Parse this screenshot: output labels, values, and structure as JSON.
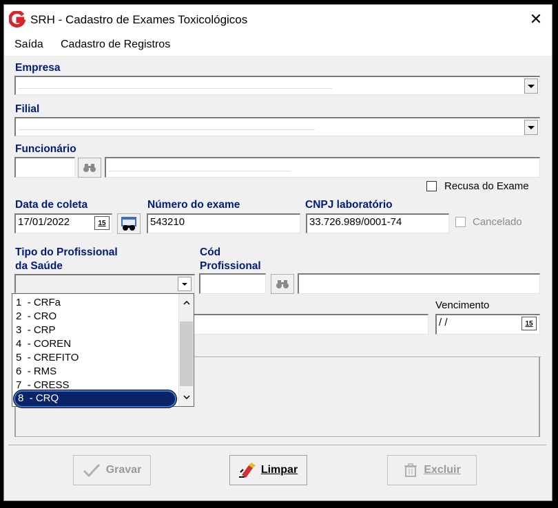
{
  "window": {
    "title": "SRH - Cadastro de Exames Toxicológicos",
    "close_glyph": "✕"
  },
  "menu": {
    "items": [
      "Saída",
      "Cadastro de Registros"
    ]
  },
  "form": {
    "empresa_label": "Empresa",
    "filial_label": "Filial",
    "funcionario_label": "Funcionário",
    "recusa_label": "Recusa do Exame",
    "data_coleta_label": "Data de coleta",
    "data_coleta_value": "17/01/2022",
    "numero_exame_label": "Número do exame",
    "numero_exame_value": "543210",
    "cnpj_label": "CNPJ laboratório",
    "cnpj_value": "33.726.989/0001-74",
    "cancelado_label": "Cancelado",
    "tipo_prof_label_1": "Tipo do Profissional",
    "tipo_prof_label_2": "da Saúde",
    "cod_prof_label_1": "Cód",
    "cod_prof_label_2": "Profissional",
    "vencimento_label": "Vencimento",
    "vencimento_value": " / /",
    "calendar_day": "15"
  },
  "dropdown_list": {
    "items": [
      {
        "num": "1",
        "text": "- CRFa"
      },
      {
        "num": "2",
        "text": "- CRO"
      },
      {
        "num": "3",
        "text": "- CRP"
      },
      {
        "num": "4",
        "text": "- COREN"
      },
      {
        "num": "5",
        "text": "- CREFITO"
      },
      {
        "num": "6",
        "text": "- RMS"
      },
      {
        "num": "7",
        "text": "- CRESS"
      },
      {
        "num": "8",
        "text": "- CRQ"
      }
    ],
    "selected_index": 7
  },
  "buttons": {
    "gravar": "Gravar",
    "limpar": "Limpar",
    "excluir": "Excluir"
  },
  "colors": {
    "label": "#001c7a",
    "selection": "#0a246a",
    "highlight_outline": "#3a7bd5",
    "brand_red": "#d9232d"
  }
}
